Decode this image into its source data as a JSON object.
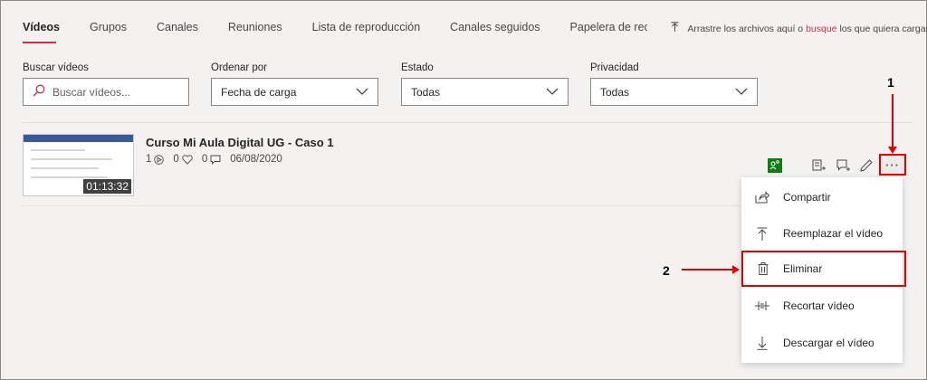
{
  "tabs": [
    "Vídeos",
    "Grupos",
    "Canales",
    "Reuniones",
    "Lista de reproducción",
    "Canales seguidos",
    "Papelera de recic"
  ],
  "upload": {
    "text_before": "Arrastre los archivos aquí o ",
    "link": "busque",
    "text_after": " los que quiera cargar."
  },
  "filters": {
    "search": {
      "label": "Buscar vídeos",
      "placeholder": "Buscar vídeos..."
    },
    "sort": {
      "label": "Ordenar por",
      "value": "Fecha de carga"
    },
    "status": {
      "label": "Estado",
      "value": "Todas"
    },
    "privacy": {
      "label": "Privacidad",
      "value": "Todas"
    }
  },
  "video": {
    "title": "Curso Mi Aula Digital UG - Caso 1",
    "views": "1",
    "likes": "0",
    "comments": "0",
    "date": "06/08/2020",
    "duration": "01:13:32"
  },
  "more_label": "···",
  "menu": [
    "Compartir",
    "Reemplazar el vídeo",
    "Eliminar",
    "Recortar vídeo",
    "Descargar el vídeo"
  ],
  "callouts": {
    "one": "1",
    "two": "2"
  },
  "colors": {
    "accent": "#c4314b",
    "highlight": "#e00000",
    "badge": "#107c10"
  }
}
